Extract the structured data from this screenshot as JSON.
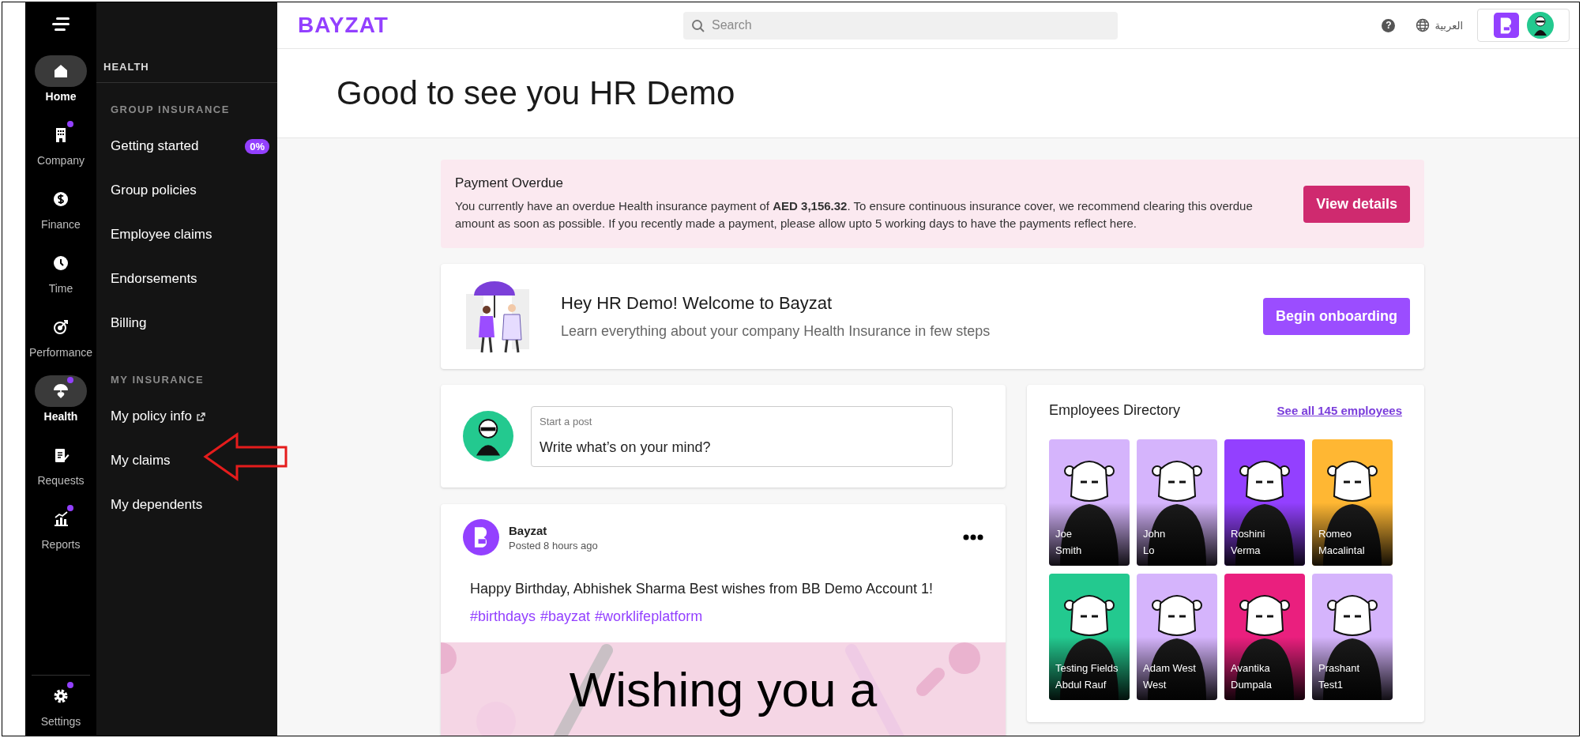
{
  "rail": {
    "items": [
      {
        "label": "Home",
        "kind": "home",
        "selected": true,
        "badge": false
      },
      {
        "label": "Company",
        "kind": "company",
        "selected": false,
        "badge": true
      },
      {
        "label": "Finance",
        "kind": "finance",
        "selected": false,
        "badge": false
      },
      {
        "label": "Time",
        "kind": "time",
        "selected": false,
        "badge": false
      },
      {
        "label": "Performance",
        "kind": "performance",
        "selected": false,
        "badge": false
      },
      {
        "label": "Health",
        "kind": "health",
        "selected": true,
        "badge": true
      },
      {
        "label": "Requests",
        "kind": "requests",
        "selected": false,
        "badge": false
      },
      {
        "label": "Reports",
        "kind": "reports",
        "selected": false,
        "badge": true
      }
    ],
    "settings": {
      "label": "Settings",
      "kind": "settings",
      "selected": false,
      "badge": true
    }
  },
  "subnav": {
    "title": "HEALTH",
    "sections": [
      {
        "heading": "GROUP INSURANCE",
        "items": [
          {
            "label": "Getting started",
            "badge": "0%",
            "external": false
          },
          {
            "label": "Group policies",
            "external": false
          },
          {
            "label": "Employee claims",
            "external": false
          },
          {
            "label": "Endorsements",
            "external": false
          },
          {
            "label": "Billing",
            "external": false
          }
        ]
      },
      {
        "heading": "MY INSURANCE",
        "items": [
          {
            "label": "My policy info",
            "external": true
          },
          {
            "label": "My claims",
            "external": false
          },
          {
            "label": "My dependents",
            "external": false
          }
        ]
      }
    ]
  },
  "topbar": {
    "logo": "BAYZAT",
    "search": {
      "placeholder": "Search"
    },
    "help": "?",
    "language": "العربية"
  },
  "greeting": "Good to see you HR Demo",
  "alert": {
    "title": "Payment Overdue",
    "message": "You currently have an overdue Health insurance payment of **AED 3,156.32**. To ensure continuous insurance cover, we recommend clearing this overdue amount as soon as possible. If you recently made a payment, please allow upto 5 working days to have the payments reflect here.",
    "button": "View details"
  },
  "welcome": {
    "title": "Hey HR Demo! Welcome to Bayzat",
    "subtitle": "Learn everything about your company Health Insurance in few steps",
    "button": "Begin onboarding"
  },
  "composer": {
    "label": "Start a post",
    "placeholder": "Write what’s on your mind?"
  },
  "post": {
    "author": "Bayzat",
    "time": "Posted 8 hours ago",
    "text": "Happy Birthday, Abhishek Sharma Best wishes from BB Demo Account 1!",
    "hashtags": [
      "#birthdays",
      "#bayzat",
      "#worklifeplatform"
    ],
    "banner_text": "Wishing you a"
  },
  "directory": {
    "title": "Employees Directory",
    "link": "See all 145 employees",
    "employees": [
      {
        "first_name": "Joe",
        "last_name": "Smith",
        "color": "#d5b4fc"
      },
      {
        "first_name": "John",
        "last_name": "Lo",
        "color": "#d5b4fc"
      },
      {
        "first_name": "Roshini",
        "last_name": "Verma",
        "color": "#9340ff"
      },
      {
        "first_name": "Romeo",
        "last_name": "Macalintal",
        "color": "#ffb733"
      },
      {
        "first_name": "Testing Fields",
        "last_name": "Abdul Rauf",
        "color": "#23c98f"
      },
      {
        "first_name": "Adam West",
        "last_name": "West",
        "color": "#d5b4fc"
      },
      {
        "first_name": "Avantika",
        "last_name": "Dumpala",
        "color": "#ea1f7e"
      },
      {
        "first_name": "Prashant",
        "last_name": "Test1",
        "color": "#d5b4fc"
      }
    ]
  }
}
